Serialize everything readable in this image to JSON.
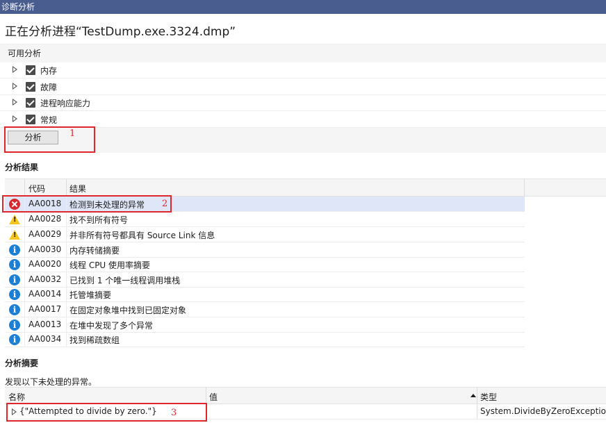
{
  "window": {
    "title": "诊断分析"
  },
  "heading": "正在分析进程“TestDump.exe.3324.dmp”",
  "available": {
    "header": "可用分析",
    "items": [
      {
        "label": "内存",
        "checked": true
      },
      {
        "label": "故障",
        "checked": true
      },
      {
        "label": "进程响应能力",
        "checked": true
      },
      {
        "label": "常规",
        "checked": true
      }
    ],
    "analyze_button": "分析"
  },
  "results": {
    "title": "分析结果",
    "columns": {
      "code": "代码",
      "result": "结果"
    },
    "rows": [
      {
        "icon": "error-icon",
        "code": "AA0018",
        "text": "检测到未处理的异常"
      },
      {
        "icon": "warning-icon",
        "code": "AA0028",
        "text": "找不到所有符号"
      },
      {
        "icon": "warning-icon",
        "code": "AA0029",
        "text": "并非所有符号都具有 Source Link 信息"
      },
      {
        "icon": "info-icon",
        "code": "AA0030",
        "text": "内存转储摘要"
      },
      {
        "icon": "info-icon",
        "code": "AA0020",
        "text": "线程 CPU 使用率摘要"
      },
      {
        "icon": "info-icon",
        "code": "AA0032",
        "text": "已找到 1 个唯一线程调用堆栈"
      },
      {
        "icon": "info-icon",
        "code": "AA0014",
        "text": "托管堆摘要"
      },
      {
        "icon": "info-icon",
        "code": "AA0017",
        "text": "在固定对象堆中找到已固定对象"
      },
      {
        "icon": "info-icon",
        "code": "AA0013",
        "text": "在堆中发现了多个异常"
      },
      {
        "icon": "info-icon",
        "code": "AA0034",
        "text": "找到稀疏数组"
      }
    ]
  },
  "summary": {
    "title": "分析摘要",
    "description": "发现以下未处理的异常。",
    "columns": {
      "name": "名称",
      "value": "值",
      "type": "类型"
    },
    "row": {
      "name": "{\"Attempted to divide by zero.\"}",
      "value": "",
      "type": "System.DivideByZeroException"
    }
  },
  "annotations": [
    "1",
    "2",
    "3"
  ],
  "colors": {
    "titlebar": "#4a5d8f",
    "selection": "#dfe6f7",
    "annotation": "#e0262b",
    "error": "#d8282f",
    "warning": "#f5c520",
    "info": "#1c7fd6"
  }
}
